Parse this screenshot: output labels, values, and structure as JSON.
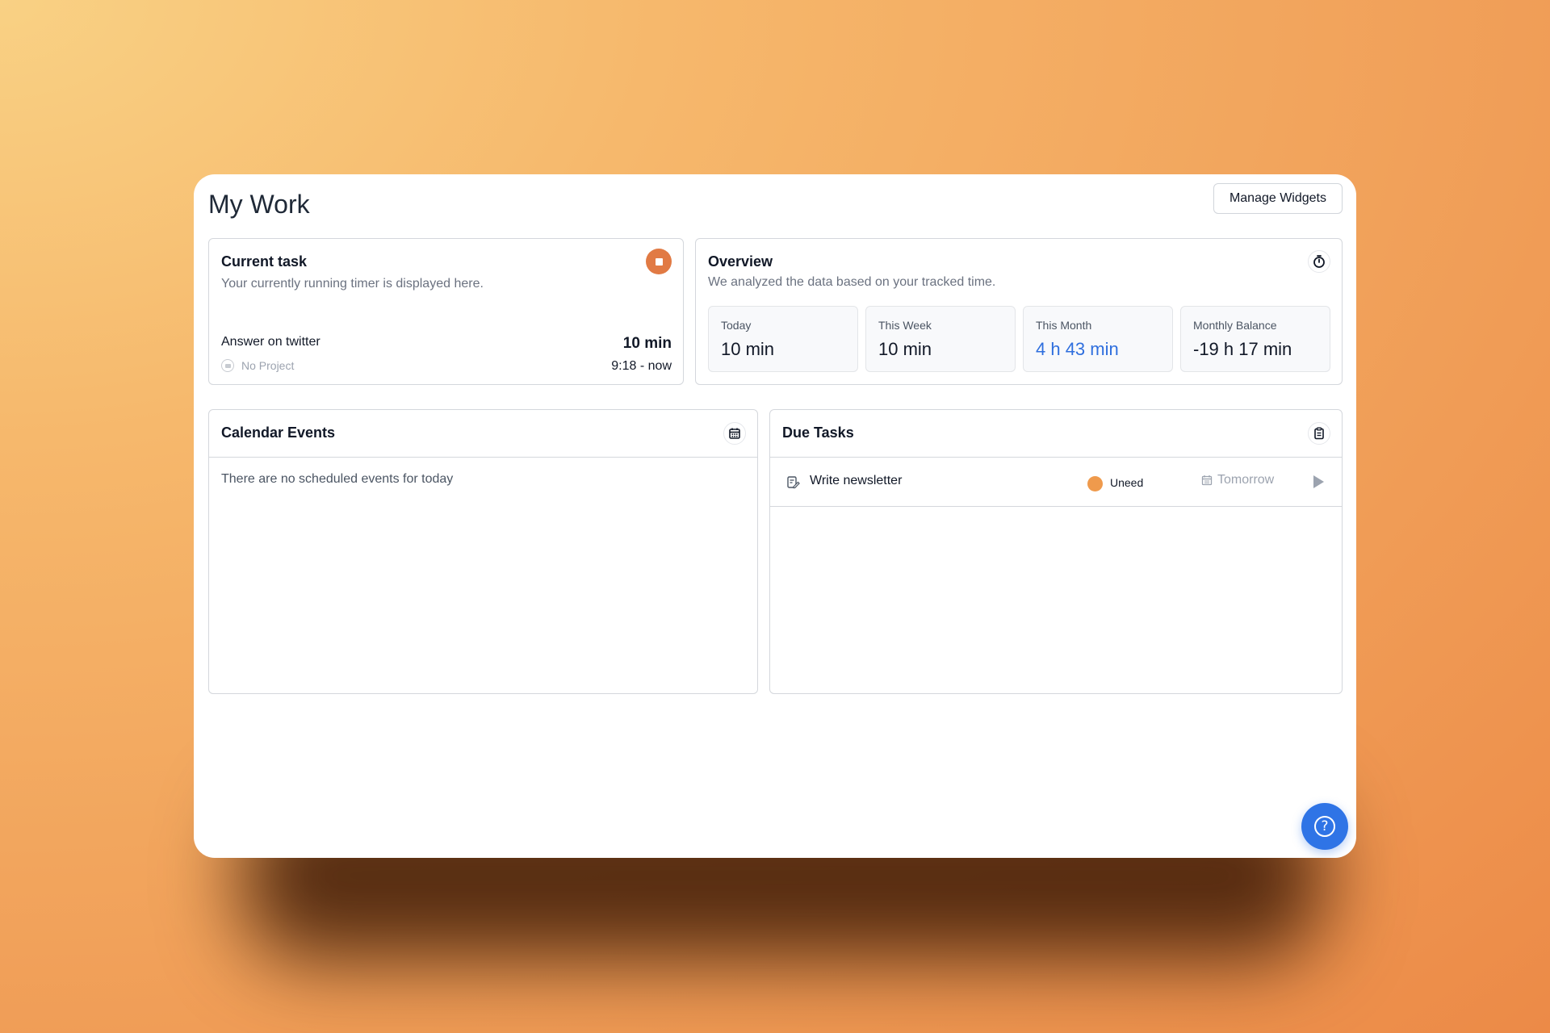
{
  "page": {
    "title": "My Work",
    "manage_widgets_label": "Manage Widgets"
  },
  "current_task": {
    "title": "Current task",
    "subtitle": "Your currently running timer is displayed here.",
    "task_name": "Answer on twitter",
    "duration": "10 min",
    "project": "No Project",
    "time_range": "9:18 - now",
    "accent_color": "#e17a44"
  },
  "overview": {
    "title": "Overview",
    "subtitle": "We analyzed the data based on your tracked time.",
    "stats": [
      {
        "label": "Today",
        "value": "10 min"
      },
      {
        "label": "This Week",
        "value": "10 min"
      },
      {
        "label": "This Month",
        "value": "4 h 43 min",
        "color": "#2f6fde"
      },
      {
        "label": "Monthly Balance",
        "value": "-19 h 17 min"
      }
    ]
  },
  "calendar": {
    "title": "Calendar Events",
    "empty_text": "There are no scheduled events for today"
  },
  "due_tasks": {
    "title": "Due Tasks",
    "rows": [
      {
        "title": "Write newsletter",
        "status": "Uneed",
        "status_color": "#ef9a4c",
        "due": "Tomorrow"
      }
    ]
  },
  "icons": {
    "stop": "stop-icon",
    "timer": "stopwatch-icon",
    "calendar": "calendar-icon",
    "clipboard": "clipboard-icon",
    "task": "edit-note-icon",
    "play": "play-icon",
    "help": "help-icon"
  },
  "colors": {
    "help_button": "#2f74e6",
    "link_blue": "#2f6fde"
  }
}
